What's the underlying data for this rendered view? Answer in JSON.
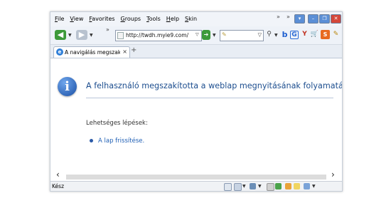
{
  "menu": {
    "items": [
      "File",
      "View",
      "Favorites",
      "Groups",
      "Tools",
      "Help",
      "Skin"
    ]
  },
  "toolbar": {
    "address_url": "http://twdh.myie9.com/"
  },
  "tab": {
    "title": "A navigálás megszakítv",
    "close_glyph": "×",
    "new_tab_glyph": "+"
  },
  "page": {
    "heading": "A felhasználó megszakította a weblap megnyitásának folyamatát",
    "steps_label": "Lehetséges lépések:",
    "reload_link": "A lap frissítése."
  },
  "status": {
    "text": "Kész"
  },
  "icons": {
    "back": "back-arrow-icon",
    "forward": "forward-arrow-icon",
    "info": "information-icon"
  },
  "colors": {
    "heading": "#1d4e8f",
    "link": "#1f5fb5",
    "close_button": "#d4473a",
    "window_button": "#5b8fd6"
  }
}
